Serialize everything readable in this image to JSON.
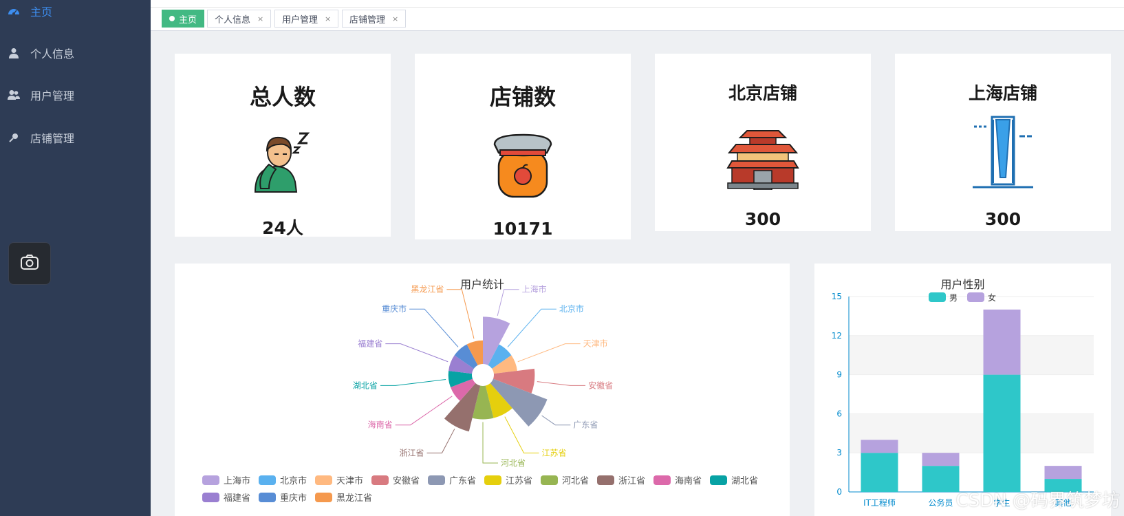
{
  "sidebar": {
    "items": [
      {
        "label": "主页",
        "icon": "dashboard-icon",
        "active": true
      },
      {
        "label": "个人信息",
        "icon": "user-icon",
        "active": false
      },
      {
        "label": "用户管理",
        "icon": "users-icon",
        "active": false
      },
      {
        "label": "店铺管理",
        "icon": "pin-icon",
        "active": false
      }
    ]
  },
  "tabs": [
    {
      "label": "主页",
      "active": true
    },
    {
      "label": "个人信息",
      "close": "×"
    },
    {
      "label": "用户管理",
      "close": "×"
    },
    {
      "label": "店铺管理",
      "close": "×"
    }
  ],
  "cards": [
    {
      "title": "总人数",
      "value": "24人",
      "icon": "sleepy-person-icon"
    },
    {
      "title": "店铺数",
      "value": "10171",
      "icon": "jam-jar-icon"
    },
    {
      "title": "北京店铺",
      "value": "300",
      "icon": "beijing-gate-icon"
    },
    {
      "title": "上海店铺",
      "value": "300",
      "icon": "shanghai-tower-icon"
    }
  ],
  "chart_data": [
    {
      "type": "pie",
      "title": "用户统计",
      "rose": true,
      "categories": [
        "上海市",
        "北京市",
        "天津市",
        "安徽省",
        "广东省",
        "江苏省",
        "河北省",
        "浙江省",
        "海南省",
        "湖北省",
        "福建省",
        "重庆市",
        "黑龙江省"
      ],
      "values": [
        4,
        1,
        1,
        3,
        6,
        2,
        2,
        4,
        1,
        1,
        1,
        1,
        1
      ],
      "colors": [
        "#b6a2de",
        "#5ab1ef",
        "#ffb980",
        "#d87a80",
        "#8d98b3",
        "#e5cf0d",
        "#97b552",
        "#95706d",
        "#dc69aa",
        "#07a2a4",
        "#9a7fd1",
        "#588dd5",
        "#f5994e"
      ],
      "legend": "bottom"
    },
    {
      "type": "bar",
      "stacked": true,
      "title": "用户性别",
      "categories": [
        "IT工程师",
        "公务员",
        "学生",
        "其他"
      ],
      "series": [
        {
          "name": "男",
          "values": [
            3,
            2,
            9,
            1
          ],
          "color": "#2ec7c9"
        },
        {
          "name": "女",
          "values": [
            1,
            1,
            5,
            1
          ],
          "color": "#b6a2de"
        }
      ],
      "ylim": [
        0,
        15
      ],
      "yticks": [
        0,
        3,
        6,
        9,
        12,
        15
      ],
      "legend": "top"
    }
  ],
  "watermark": "CSDN @码界筑梦坊"
}
